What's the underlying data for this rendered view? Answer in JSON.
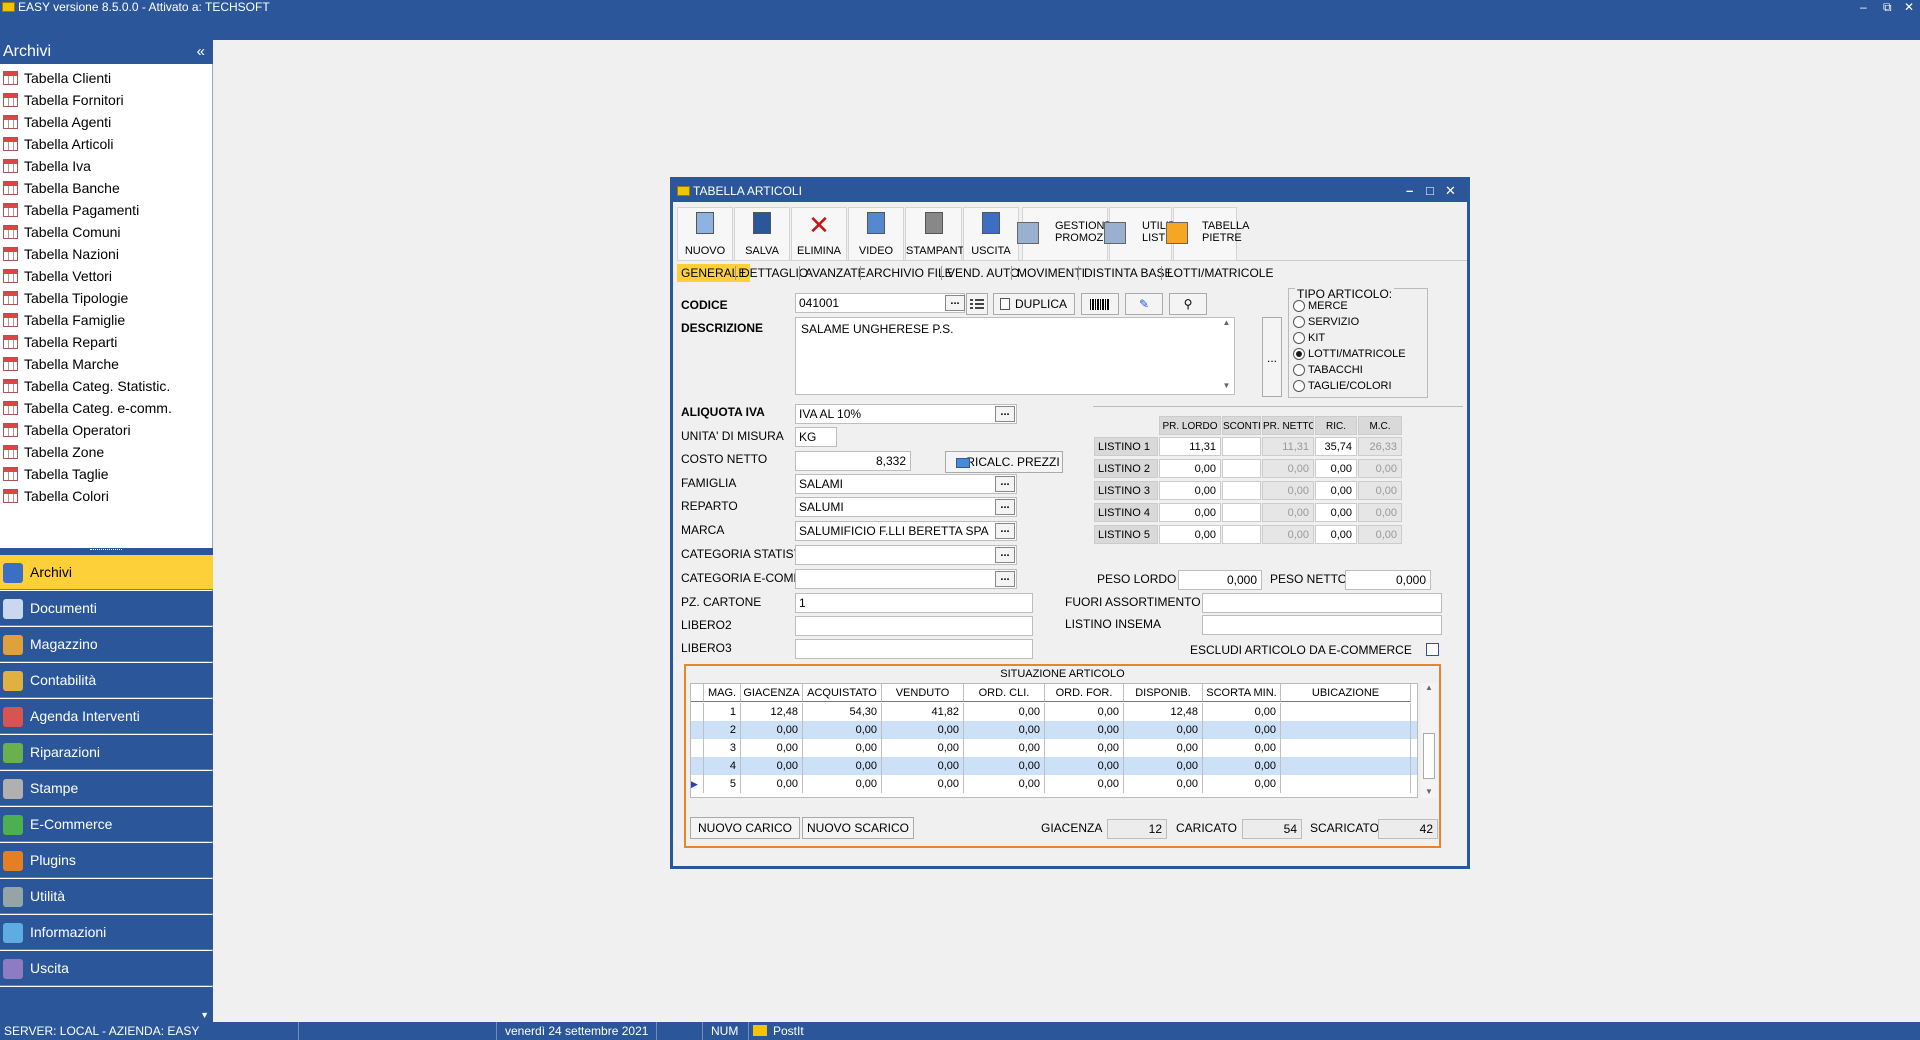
{
  "app": {
    "title": "EASY versione 8.5.0.0 - Attivato a: TECHSOFT",
    "win_minimize": "–",
    "win_restore": "⧉",
    "win_close": "✕"
  },
  "sidebar": {
    "title": "Archivi",
    "collapse_label": "«",
    "archive_items": [
      "Tabella Clienti",
      "Tabella Fornitori",
      "Tabella Agenti",
      "Tabella Articoli",
      "Tabella Iva",
      "Tabella Banche",
      "Tabella Pagamenti",
      "Tabella Comuni",
      "Tabella Nazioni",
      "Tabella Vettori",
      "Tabella Tipologie",
      "Tabella Famiglie",
      "Tabella Reparti",
      "Tabella Marche",
      "Tabella Categ. Statistic.",
      "Tabella Categ. e-comm.",
      "Tabella Operatori",
      "Tabella Zone",
      "Tabella Taglie",
      "Tabella Colori"
    ],
    "nav": [
      {
        "label": "Archivi",
        "icon": "archive-icon",
        "color": "#3b6fc4"
      },
      {
        "label": "Documenti",
        "icon": "documents-icon",
        "color": "#c9d8ef"
      },
      {
        "label": "Magazzino",
        "icon": "warehouse-icon",
        "color": "#e0a03a"
      },
      {
        "label": "Contabilità",
        "icon": "scales-icon",
        "color": "#e0b040"
      },
      {
        "label": "Agenda Interventi",
        "icon": "agenda-icon",
        "color": "#d9534f"
      },
      {
        "label": "Riparazioni",
        "icon": "repair-icon",
        "color": "#6ab04c"
      },
      {
        "label": "Stampe",
        "icon": "printer-icon",
        "color": "#b0b0b0"
      },
      {
        "label": "E-Commerce",
        "icon": "globe-icon",
        "color": "#4caf50"
      },
      {
        "label": "Plugins",
        "icon": "plugin-icon",
        "color": "#e67e22"
      },
      {
        "label": "Utilità",
        "icon": "tools-icon",
        "color": "#95a5a6"
      },
      {
        "label": "Informazioni",
        "icon": "info-icon",
        "color": "#5dade2"
      },
      {
        "label": "Uscita",
        "icon": "exit-icon",
        "color": "#8e7cc3"
      }
    ]
  },
  "statusbar": {
    "server": "SERVER: LOCAL - AZIENDA: EASY",
    "date": "venerdì 24 settembre 2021",
    "num": "NUM",
    "postit": "PostIt"
  },
  "dialog": {
    "title": "TABELLA ARTICOLI",
    "toolbar": [
      {
        "label": "NUOVO",
        "icon": "new-document-icon"
      },
      {
        "label": "SALVA",
        "icon": "save-icon"
      },
      {
        "label": "ELIMINA",
        "icon": "delete-icon"
      },
      {
        "label": "VIDEO",
        "icon": "preview-icon"
      },
      {
        "label": "STAMPANTE",
        "icon": "printer-icon"
      },
      {
        "label": "USCITA",
        "icon": "exit-door-icon"
      }
    ],
    "toolbar2": [
      {
        "l1": "GESTIONE",
        "l2": "PROMOZIONI",
        "icon": "promotions-icon"
      },
      {
        "l1": "UTILITY",
        "l2": "LISTINI",
        "icon": "utility-pricelist-icon"
      },
      {
        "l1": "TABELLA",
        "l2": "PIETRE",
        "icon": "stones-table-icon"
      }
    ],
    "tabs": [
      "GENERALE",
      "DETTAGLIO",
      "AVANZATE",
      "ARCHIVIO FILE",
      "VEND. AUTO",
      "MOVIMENTI",
      "DISTINTA BASE",
      "LOTTI/MATRICOLE"
    ],
    "fields": {
      "codice_label": "CODICE",
      "codice": "041001",
      "duplica": "DUPLICA",
      "descrizione_label": "DESCRIZIONE",
      "descrizione": "SALAME UNGHERESE P.S.",
      "aliquota_label": "ALIQUOTA IVA",
      "aliquota": "IVA AL 10%",
      "um_label": "UNITA' DI MISURA",
      "um": "KG",
      "costo_label": "COSTO NETTO",
      "costo": "8,332",
      "ricalc": "RICALC. PREZZI",
      "famiglia_label": "FAMIGLIA",
      "famiglia": "SALAMI",
      "reparto_label": "REPARTO",
      "reparto": "SALUMI",
      "marca_label": "MARCA",
      "marca": "SALUMIFICIO F.LLI BERETTA SPA",
      "catstat_label": "CATEGORIA STATIST.",
      "catstat": "",
      "catecomm_label": "CATEGORIA E-COMM.",
      "catecomm": "",
      "pzcart_label": "PZ. CARTONE",
      "pzcart": "1",
      "libero2_label": "LIBERO2",
      "libero2": "",
      "libero3_label": "LIBERO3",
      "libero3": "",
      "peso_lordo_label": "PESO LORDO",
      "peso_lordo": "0,000",
      "peso_netto_label": "PESO NETTO",
      "peso_netto": "0,000",
      "fuori_label": "FUORI ASSORTIMENTO",
      "fuori": "",
      "insema_label": "LISTINO INSEMA",
      "insema": "",
      "escludi_label": "ESCLUDI ARTICOLO DA E-COMMERCE",
      "dots": "..."
    },
    "tipo": {
      "title": "TIPO ARTICOLO:",
      "options": [
        "MERCE",
        "SERVIZIO",
        "KIT",
        "LOTTI/MATRICOLE",
        "TABACCHI",
        "TAGLIE/COLORI"
      ],
      "selected": "LOTTI/MATRICOLE"
    },
    "listini": {
      "headers": [
        "PR. LORDO",
        "SCONTI",
        "PR. NETTO",
        "RIC.",
        "M.C."
      ],
      "rows": [
        {
          "name": "LISTINO 1",
          "lordo": "11,31",
          "sconti": "",
          "netto": "11,31",
          "ric": "35,74",
          "mc": "26,33"
        },
        {
          "name": "LISTINO 2",
          "lordo": "0,00",
          "sconti": "",
          "netto": "0,00",
          "ric": "0,00",
          "mc": "0,00"
        },
        {
          "name": "LISTINO 3",
          "lordo": "0,00",
          "sconti": "",
          "netto": "0,00",
          "ric": "0,00",
          "mc": "0,00"
        },
        {
          "name": "LISTINO 4",
          "lordo": "0,00",
          "sconti": "",
          "netto": "0,00",
          "ric": "0,00",
          "mc": "0,00"
        },
        {
          "name": "LISTINO 5",
          "lordo": "0,00",
          "sconti": "",
          "netto": "0,00",
          "ric": "0,00",
          "mc": "0,00"
        }
      ]
    },
    "situazione": {
      "title": "SITUAZIONE ARTICOLO",
      "headers": [
        "MAG.",
        "GIACENZA",
        "ACQUISTATO",
        "VENDUTO",
        "ORD. CLI.",
        "ORD. FOR.",
        "DISPONIB.",
        "SCORTA MIN.",
        "UBICAZIONE"
      ],
      "rows": [
        [
          "1",
          "12,48",
          "54,30",
          "41,82",
          "0,00",
          "0,00",
          "12,48",
          "0,00",
          ""
        ],
        [
          "2",
          "0,00",
          "0,00",
          "0,00",
          "0,00",
          "0,00",
          "0,00",
          "0,00",
          ""
        ],
        [
          "3",
          "0,00",
          "0,00",
          "0,00",
          "0,00",
          "0,00",
          "0,00",
          "0,00",
          ""
        ],
        [
          "4",
          "0,00",
          "0,00",
          "0,00",
          "0,00",
          "0,00",
          "0,00",
          "0,00",
          ""
        ],
        [
          "5",
          "0,00",
          "0,00",
          "0,00",
          "0,00",
          "0,00",
          "0,00",
          "0,00",
          ""
        ]
      ],
      "nuovo_carico": "NUOVO CARICO",
      "nuovo_scarico": "NUOVO SCARICO",
      "giacenza_label": "GIACENZA",
      "giacenza": "12",
      "caricato_label": "CARICATO",
      "caricato": "54",
      "scaricato_label": "SCARICATO",
      "scaricato": "42"
    }
  }
}
